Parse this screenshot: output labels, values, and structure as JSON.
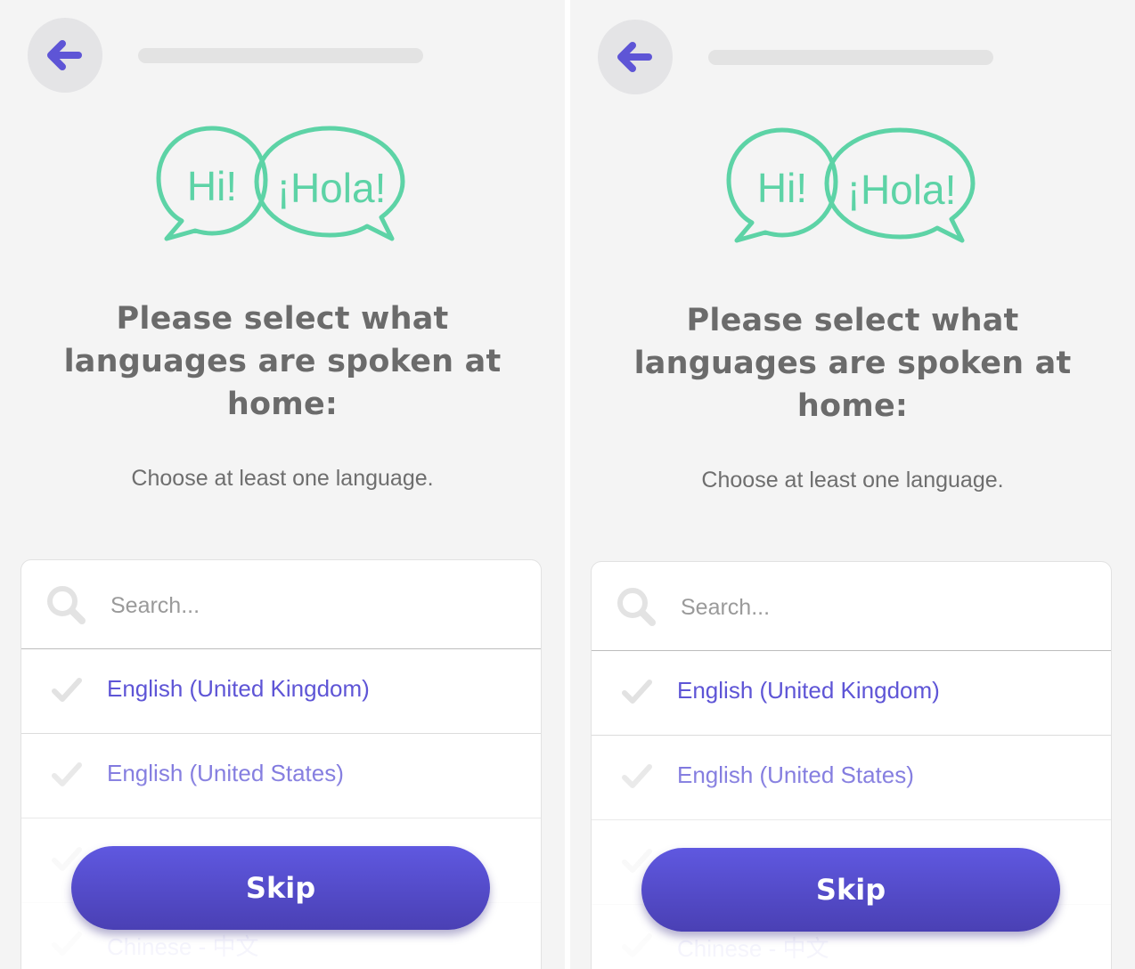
{
  "screens": [
    {
      "hero": {
        "bubble_left": "Hi!",
        "bubble_right": "¡Hola!"
      },
      "title": "Please select what languages are spoken at home:",
      "subtitle": "Choose at least one language.",
      "search": {
        "placeholder": "Search..."
      },
      "languages": [
        {
          "label": "English (United Kingdom)"
        },
        {
          "label": "English (United States)"
        },
        {
          "label": ""
        },
        {
          "label": "Chinese - 中文"
        }
      ],
      "skip_label": "Skip"
    },
    {
      "hero": {
        "bubble_left": "Hi!",
        "bubble_right": "¡Hola!"
      },
      "title": "Please select what languages are spoken at home:",
      "subtitle": "Choose at least one language.",
      "search": {
        "placeholder": "Search..."
      },
      "languages": [
        {
          "label": "English (United Kingdom)"
        },
        {
          "label": "English (United States)"
        },
        {
          "label": ""
        },
        {
          "label": "Chinese - 中文"
        }
      ],
      "skip_label": "Skip"
    }
  ],
  "colors": {
    "accent": "#5e55d6",
    "hero_green": "#5dd3a6",
    "background": "#f4f4f4"
  },
  "icons": {
    "back": "arrow-left-icon",
    "search": "search-icon",
    "check": "check-icon"
  }
}
